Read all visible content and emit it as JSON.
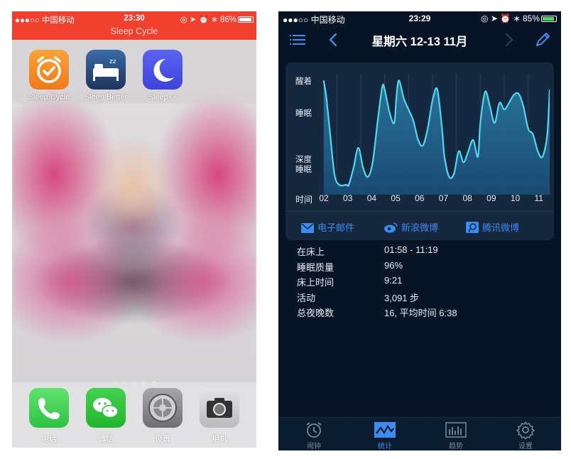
{
  "left_phone": {
    "status_bar": {
      "carrier": "●●●○○ 中国移动",
      "time": "23:30",
      "battery": "86%",
      "subtitle": "Sleep Cycle"
    },
    "apps": [
      {
        "label": "Sleep Cycle",
        "icon": "sleep-cycle-alarm-icon",
        "color": "#f5892a"
      },
      {
        "label": "Sleep Better",
        "icon": "bed-icon",
        "color": "#2a4c7e"
      },
      {
        "label": "Sleep++",
        "icon": "moon-icon",
        "color": "#4f55e8"
      }
    ],
    "page_dots": 5,
    "active_dot": 5,
    "dock": [
      {
        "label": "电话",
        "icon": "phone-icon",
        "color": "#3fd45a"
      },
      {
        "label": "微信",
        "icon": "wechat-icon",
        "color": "#2dc13c"
      },
      {
        "label": "设置",
        "icon": "settings-gear-icon",
        "color": "#8e8e93"
      },
      {
        "label": "相机",
        "icon": "camera-icon",
        "color": "#6d6d72"
      }
    ]
  },
  "right_phone": {
    "status_bar": {
      "carrier": "●●●○○ 中国移动",
      "time": "23:29",
      "battery": "85%"
    },
    "nav": {
      "title": "星期六 12-13 11月"
    },
    "chart_data": {
      "type": "area",
      "y_labels": [
        "醒着",
        "睡眠",
        "深度\n睡眠"
      ],
      "x_label": "时间",
      "x_ticks": [
        "02",
        "03",
        "04",
        "05",
        "06",
        "07",
        "08",
        "09",
        "10",
        "11"
      ],
      "y_range": [
        0,
        1
      ],
      "x_range": [
        1.9,
        11.4
      ],
      "x": [
        1.95,
        2.05,
        2.2,
        2.4,
        2.6,
        2.9,
        3.0,
        3.2,
        3.4,
        3.6,
        3.8,
        4.0,
        4.2,
        4.4,
        4.5,
        4.7,
        4.9,
        5.0,
        5.1,
        5.3,
        5.5,
        5.7,
        5.9,
        6.1,
        6.3,
        6.5,
        6.7,
        6.9,
        7.0,
        7.2,
        7.4,
        7.6,
        7.8,
        8.0,
        8.2,
        8.4,
        8.5,
        8.7,
        8.9,
        9.1,
        9.3,
        9.5,
        9.7,
        9.9,
        10.1,
        10.3,
        10.5,
        10.7,
        10.9,
        11.1,
        11.3,
        11.4
      ],
      "y": [
        0.98,
        0.85,
        0.55,
        0.15,
        0.05,
        0.05,
        0.05,
        0.2,
        0.38,
        0.2,
        0.12,
        0.25,
        0.6,
        0.92,
        0.9,
        0.7,
        0.6,
        0.85,
        0.98,
        0.82,
        0.72,
        0.62,
        0.45,
        0.4,
        0.55,
        0.8,
        0.9,
        0.55,
        0.3,
        0.12,
        0.15,
        0.35,
        0.25,
        0.35,
        0.45,
        0.3,
        0.6,
        0.88,
        0.75,
        0.6,
        0.78,
        0.72,
        0.78,
        0.85,
        0.86,
        0.75,
        0.55,
        0.5,
        0.35,
        0.3,
        0.5,
        0.9
      ]
    },
    "share": [
      {
        "label": "电子邮件",
        "icon": "mail-icon"
      },
      {
        "label": "新浪微博",
        "icon": "weibo-icon"
      },
      {
        "label": "腾讯微博",
        "icon": "tencent-weibo-icon"
      }
    ],
    "stats": [
      {
        "key": "在床上",
        "value": "01:58 - 11:19"
      },
      {
        "key": "睡眠质量",
        "value": "96%"
      },
      {
        "key": "床上时间",
        "value": "9:21"
      },
      {
        "key": "活动",
        "value": "3,091 步"
      },
      {
        "key": "总夜晚数",
        "value": "16, 平均时间 6:38"
      }
    ],
    "tabs": [
      {
        "label": "闹钟",
        "icon": "alarm-clock-icon",
        "active": false
      },
      {
        "label": "统计",
        "icon": "stats-graph-icon",
        "active": true
      },
      {
        "label": "趋势",
        "icon": "trend-bars-icon",
        "active": false
      },
      {
        "label": "设置",
        "icon": "gear-icon",
        "active": false
      }
    ],
    "colors": {
      "accent": "#3d8cf0",
      "line": "#4fd8ee",
      "background": "#061426",
      "card": "#15283e"
    }
  }
}
